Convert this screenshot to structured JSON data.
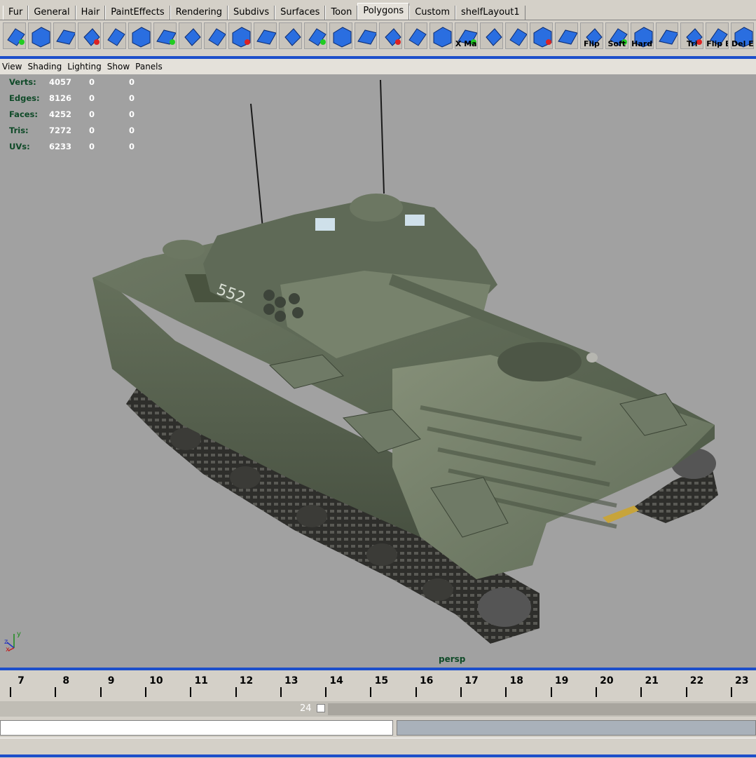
{
  "shelf": {
    "tabs": [
      {
        "label": "Fur",
        "active": false
      },
      {
        "label": "General",
        "active": false
      },
      {
        "label": "Hair",
        "active": false
      },
      {
        "label": "PaintEffects",
        "active": false
      },
      {
        "label": "Rendering",
        "active": false
      },
      {
        "label": "Subdivs",
        "active": false
      },
      {
        "label": "Surfaces",
        "active": false
      },
      {
        "label": "Toon",
        "active": false
      },
      {
        "label": "Polygons",
        "active": true
      },
      {
        "label": "Custom",
        "active": false
      },
      {
        "label": "shelfLayout1",
        "active": false
      }
    ],
    "tools": [
      {
        "icon": "sphere-poly-icon",
        "label": ""
      },
      {
        "icon": "cube-poly-icon",
        "label": ""
      },
      {
        "icon": "plane-poly-icon",
        "label": ""
      },
      {
        "icon": "cut-face-icon",
        "label": ""
      },
      {
        "icon": "extrude-face-icon",
        "label": ""
      },
      {
        "icon": "extrude-edge-icon",
        "label": ""
      },
      {
        "icon": "bevel-icon",
        "label": ""
      },
      {
        "icon": "duplicate-face-icon",
        "label": ""
      },
      {
        "icon": "split-poly-icon",
        "label": ""
      },
      {
        "icon": "merge-vertex-icon",
        "label": ""
      },
      {
        "icon": "wedge-face-icon",
        "label": ""
      },
      {
        "icon": "collapse-icon",
        "label": ""
      },
      {
        "icon": "subdivide-icon",
        "label": ""
      },
      {
        "icon": "poke-face-icon",
        "label": ""
      },
      {
        "icon": "append-poly-icon",
        "label": ""
      },
      {
        "icon": "smooth-icon",
        "label": ""
      },
      {
        "icon": "sculpt-icon",
        "label": ""
      },
      {
        "icon": "planar-map-icon",
        "label": ""
      },
      {
        "icon": "auto-map-icon",
        "label": "X Map"
      },
      {
        "icon": "cylindrical-map-icon",
        "label": ""
      },
      {
        "icon": "spherical-map-icon",
        "label": ""
      },
      {
        "icon": "uv-snapshot-icon",
        "label": ""
      },
      {
        "icon": "uv-editor-icon",
        "label": ""
      },
      {
        "icon": "flip-normals-icon",
        "label": "Flip"
      },
      {
        "icon": "soft-edge-icon",
        "label": "Soft"
      },
      {
        "icon": "hard-edge-icon",
        "label": "Hard"
      },
      {
        "icon": "torus-icon",
        "label": ""
      },
      {
        "icon": "triangulate-icon",
        "label": "Tri"
      },
      {
        "icon": "flip-edge-icon",
        "label": "Flip E"
      },
      {
        "icon": "delete-edge-icon",
        "label": "Del E"
      }
    ]
  },
  "panel_menu": [
    "View",
    "Shading",
    "Lighting",
    "Show",
    "Panels"
  ],
  "hud": [
    {
      "label": "Verts:",
      "value": "4057",
      "sel": "0",
      "uv": "0"
    },
    {
      "label": "Edges:",
      "value": "8126",
      "sel": "0",
      "uv": "0"
    },
    {
      "label": "Faces:",
      "value": "4252",
      "sel": "0",
      "uv": "0"
    },
    {
      "label": "Tris:",
      "value": "7272",
      "sel": "0",
      "uv": "0"
    },
    {
      "label": "UVs:",
      "value": "6233",
      "sel": "0",
      "uv": "0"
    }
  ],
  "viewport": {
    "camera": "persp",
    "model_number": "552",
    "axis_labels": {
      "y": "y",
      "z": "z",
      "x": "x"
    }
  },
  "timeline": {
    "frames": [
      "7",
      "8",
      "9",
      "10",
      "11",
      "12",
      "13",
      "14",
      "15",
      "16",
      "17",
      "18",
      "19",
      "20",
      "21",
      "22",
      "23"
    ]
  },
  "range": {
    "end_frame": "24"
  },
  "colors": {
    "accent_blue": "#1c4eca",
    "viewport_bg": "#a1a1a1",
    "hud_label": "#0f4a28",
    "ui_gray": "#d4d0c8",
    "tank_green": "#5e6a55"
  }
}
